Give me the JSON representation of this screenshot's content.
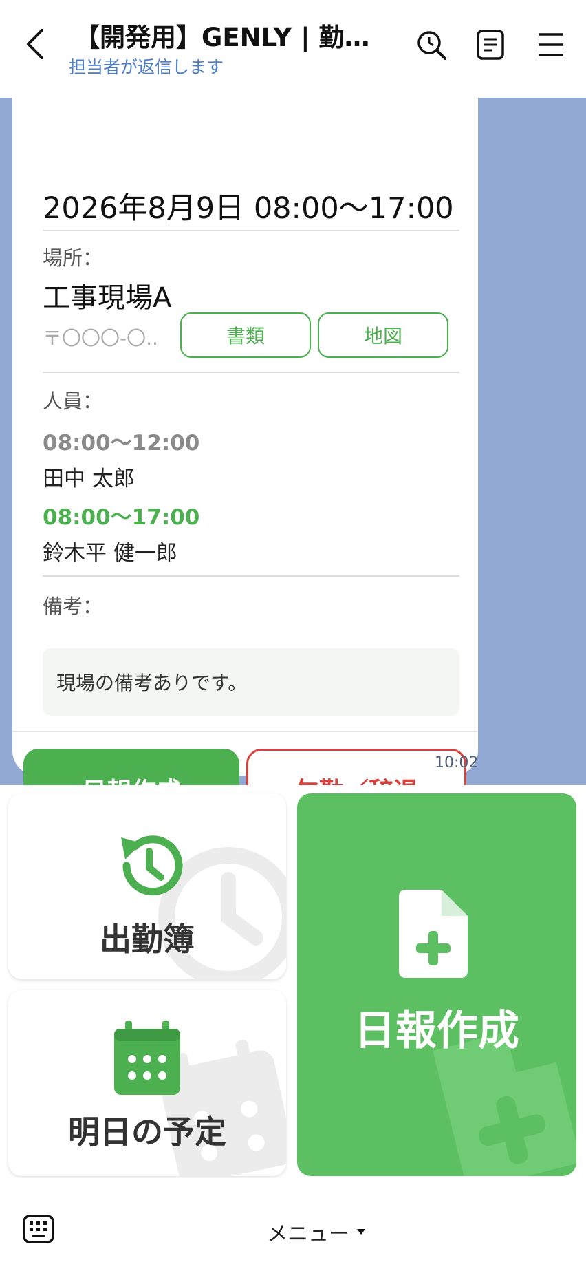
{
  "header": {
    "title": "【開発用】GENLY | 勤怠...",
    "subtitle": "担当者が返信します"
  },
  "card": {
    "date": "2026年8月9日 08:00〜17:00",
    "location_label": "場所：",
    "location_name": "工事現場A",
    "address": "〒〇〇〇-〇...",
    "documents_button": "書類",
    "map_button": "地図",
    "staff_label": "人員：",
    "staff": [
      {
        "time": "08:00〜12:00",
        "name": "田中 太郎",
        "time_color": "#8a8a8a"
      },
      {
        "time": "08:00〜17:00",
        "name": "鈴木平 健一郎",
        "time_color": "#4caf50"
      }
    ],
    "notes_label": "備考：",
    "notes": "現場の備考ありです。",
    "report_button": "日報作成",
    "absence_button": "欠勤／辞退",
    "timestamp": "10:02"
  },
  "menu": {
    "attendance": "出勤簿",
    "tomorrow": "明日の予定",
    "daily_report": "日報作成"
  },
  "bottom_bar": {
    "menu_label": "メニュー"
  },
  "colors": {
    "accent_green": "#4caf50",
    "menu_green": "#5cbf61",
    "danger_red": "#d9403b",
    "chat_background": "#91a9d3",
    "link_blue": "#4d7fc9"
  }
}
